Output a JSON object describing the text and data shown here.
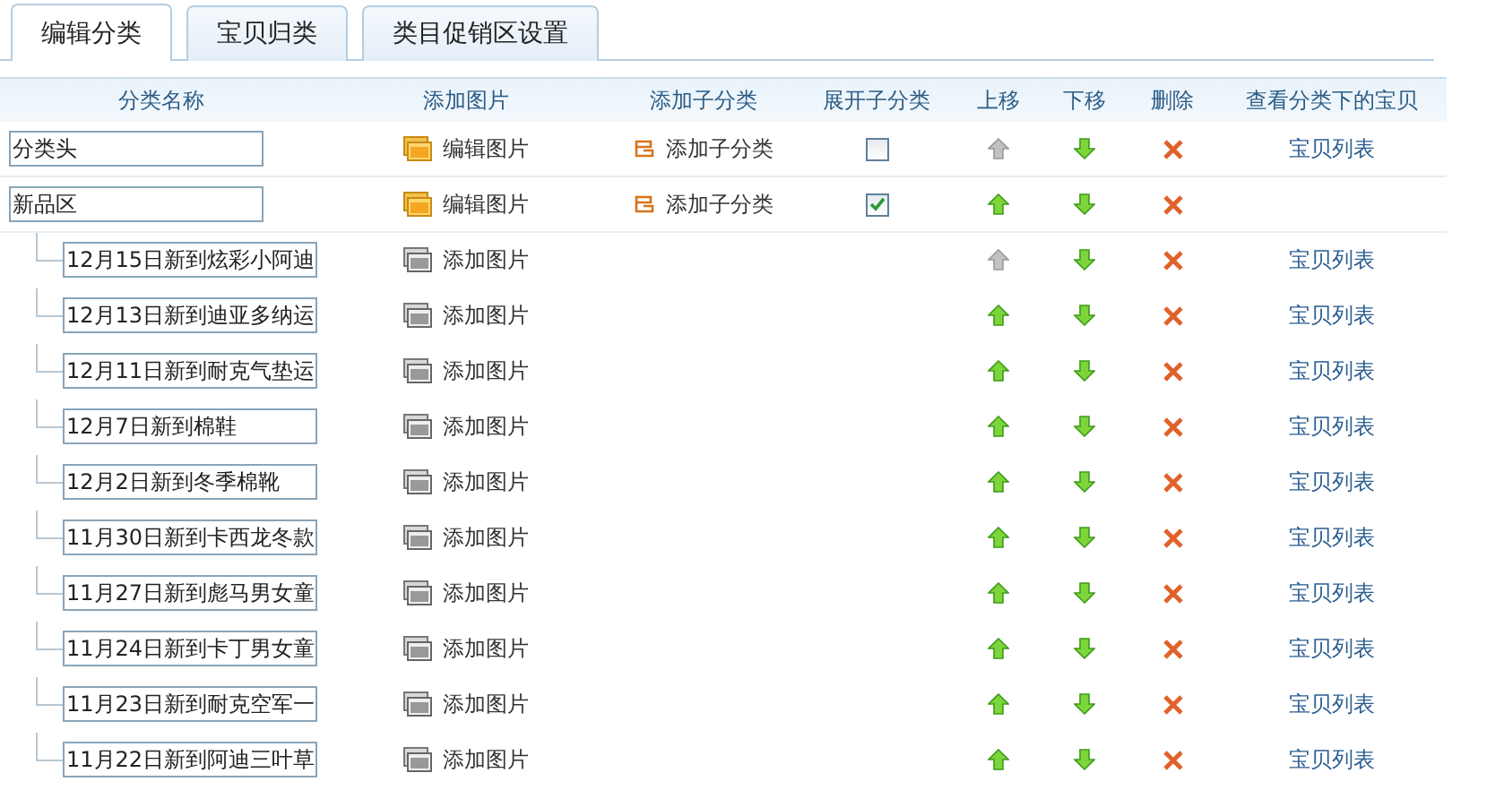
{
  "tabs": [
    {
      "label": "编辑分类",
      "selected": true
    },
    {
      "label": "宝贝归类",
      "selected": false
    },
    {
      "label": "类目促销区设置",
      "selected": false
    }
  ],
  "columns": [
    "分类名称",
    "添加图片",
    "添加子分类",
    "展开子分类",
    "上移",
    "下移",
    "删除",
    "查看分类下的宝贝"
  ],
  "categories": [
    {
      "name": "分类头",
      "image_action": "编辑图片",
      "has_image": true,
      "subcategory_action": "添加子分类",
      "expanded": false,
      "move_up_disabled": true,
      "items_link": "宝贝列表"
    },
    {
      "name": "新品区",
      "image_action": "编辑图片",
      "has_image": true,
      "subcategory_action": "添加子分类",
      "expanded": true,
      "move_up_disabled": false,
      "children": [
        {
          "name": "12月15日新到炫彩小阿迪",
          "image_action": "添加图片",
          "has_image": false,
          "move_up_disabled": true,
          "items_link": "宝贝列表"
        },
        {
          "name": "12月13日新到迪亚多纳运",
          "image_action": "添加图片",
          "has_image": false,
          "move_up_disabled": false,
          "items_link": "宝贝列表"
        },
        {
          "name": "12月11日新到耐克气垫运",
          "image_action": "添加图片",
          "has_image": false,
          "move_up_disabled": false,
          "items_link": "宝贝列表"
        },
        {
          "name": "12月7日新到棉鞋",
          "image_action": "添加图片",
          "has_image": false,
          "move_up_disabled": false,
          "items_link": "宝贝列表"
        },
        {
          "name": "12月2日新到冬季棉靴",
          "image_action": "添加图片",
          "has_image": false,
          "move_up_disabled": false,
          "items_link": "宝贝列表"
        },
        {
          "name": "11月30日新到卡西龙冬款",
          "image_action": "添加图片",
          "has_image": false,
          "move_up_disabled": false,
          "items_link": "宝贝列表"
        },
        {
          "name": "11月27日新到彪马男女童",
          "image_action": "添加图片",
          "has_image": false,
          "move_up_disabled": false,
          "items_link": "宝贝列表"
        },
        {
          "name": "11月24日新到卡丁男女童",
          "image_action": "添加图片",
          "has_image": false,
          "move_up_disabled": false,
          "items_link": "宝贝列表"
        },
        {
          "name": "11月23日新到耐克空军一",
          "image_action": "添加图片",
          "has_image": false,
          "move_up_disabled": false,
          "items_link": "宝贝列表"
        },
        {
          "name": "11月22日新到阿迪三叶草",
          "image_action": "添加图片",
          "has_image": false,
          "move_up_disabled": false,
          "items_link": "宝贝列表"
        }
      ]
    }
  ]
}
